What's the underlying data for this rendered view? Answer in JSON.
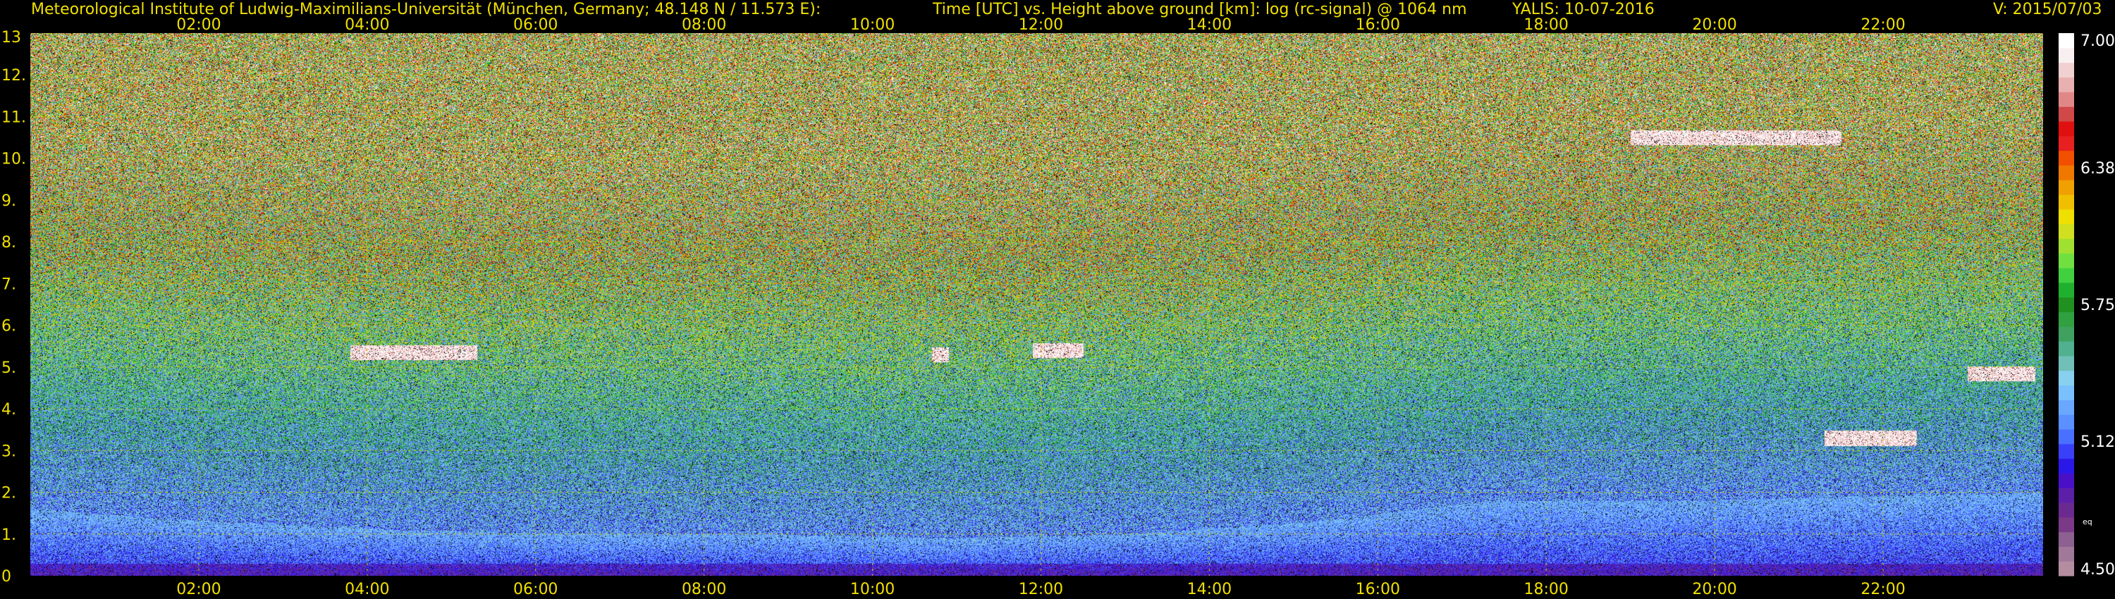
{
  "header": {
    "institute": "Meteorological Institute of Ludwig-Maximilians-Universität (München, Germany; 48.148 N / 11.573 E):",
    "plot_title": "Time [UTC] vs. Height above ground [km]: log (rc-signal) @ 1064 nm",
    "instrument_date": "YALIS: 10-07-2016",
    "version": "V: 2015/07/03"
  },
  "chart_data": {
    "type": "heatmap",
    "title": "Time [UTC] vs. Height above ground [km]: log (rc-signal) @ 1064 nm",
    "x": {
      "label": "Time [UTC]",
      "range_hours": [
        0.0,
        23.9
      ],
      "ticks_hours": [
        2,
        4,
        6,
        8,
        10,
        12,
        14,
        16,
        18,
        20,
        22
      ],
      "tick_labels": [
        "02:00",
        "04:00",
        "06:00",
        "08:00",
        "10:00",
        "12:00",
        "14:00",
        "16:00",
        "18:00",
        "20:00",
        "22:00"
      ]
    },
    "y": {
      "label": "Height above ground [km]",
      "range_km": [
        0,
        13
      ],
      "ticks": [
        0,
        1,
        2,
        3,
        4,
        5,
        6,
        7,
        8,
        9,
        10,
        11,
        12,
        13
      ],
      "tick_labels": [
        "0",
        "1.",
        "2.",
        "3.",
        "4.",
        "5.",
        "6.",
        "7.",
        "8.",
        "9.",
        "10.",
        "11.",
        "12.",
        "13"
      ]
    },
    "grid": true,
    "colorbar": {
      "range": [
        4.5,
        7.0
      ],
      "tick_values": [
        4.5,
        5.12,
        5.75,
        6.38,
        7.0
      ],
      "tick_labels": [
        "4.50",
        "5.12",
        "5.75",
        "6.38",
        "7.00"
      ],
      "extra_label": "eq",
      "colors": [
        "#b48ea0",
        "#a07898",
        "#8c6090",
        "#7a3a88",
        "#6a2a90",
        "#5c20a8",
        "#4a10c8",
        "#2a18e8",
        "#3a40f8",
        "#4a70ff",
        "#5a90ff",
        "#6aa8ff",
        "#7ac0ff",
        "#88d0ee",
        "#70c0b8",
        "#50b090",
        "#40a060",
        "#30a040",
        "#209020",
        "#20b030",
        "#40d040",
        "#70e040",
        "#a0e030",
        "#d0e020",
        "#f0e000",
        "#f0c000",
        "#f0a000",
        "#f07800",
        "#f05000",
        "#e82020",
        "#e01010",
        "#d04848",
        "#e08888",
        "#e8b0b0",
        "#f0d0d0",
        "#f8f0f0",
        "#ffffff"
      ]
    },
    "features": [
      {
        "type": "aerosol boundary layer",
        "t_start": 0.0,
        "t_end": 23.9,
        "h_top_km": [
          1.6,
          1.3,
          1.1,
          1.0,
          1.0,
          0.9,
          1.0,
          1.3,
          1.8,
          1.8,
          1.9,
          2.0
        ]
      },
      {
        "type": "cloud",
        "t_start": 3.8,
        "t_end": 5.3,
        "h_km": 5.35
      },
      {
        "type": "cloud",
        "t_start": 10.7,
        "t_end": 10.9,
        "h_km": 5.3
      },
      {
        "type": "cloud",
        "t_start": 11.9,
        "t_end": 12.5,
        "h_km": 5.4
      },
      {
        "type": "cloud",
        "t_start": 19.0,
        "t_end": 21.5,
        "h_km": 10.5
      },
      {
        "type": "cloud",
        "t_start": 21.3,
        "t_end": 22.4,
        "h_km": 3.3
      },
      {
        "type": "cloud",
        "t_start": 23.0,
        "t_end": 23.8,
        "h_km": 4.85
      }
    ]
  }
}
